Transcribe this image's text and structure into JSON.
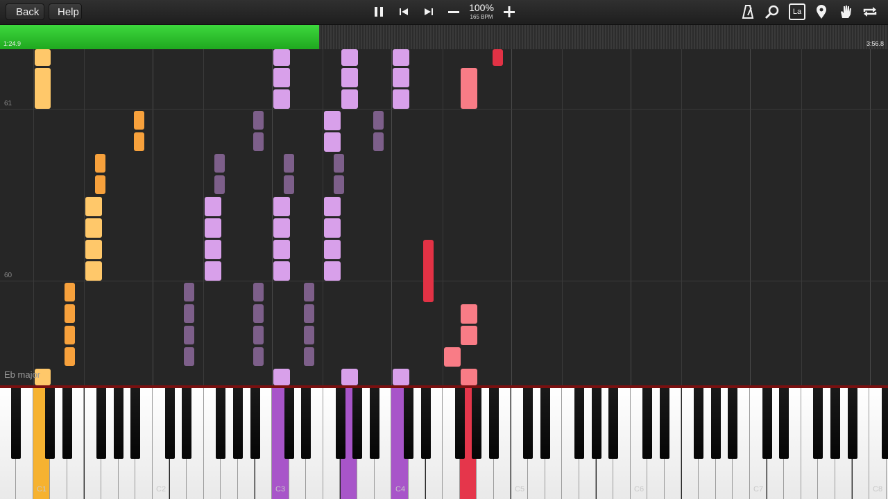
{
  "toolbar": {
    "back_label": "Back",
    "help_label": "Help",
    "speed": "100%",
    "bpm": "165 BPM",
    "icons": [
      "pause-icon",
      "skip-previous-icon",
      "skip-next-icon",
      "minus-icon",
      "plus-icon",
      "metronome-icon",
      "zoom-icon",
      "label-icon",
      "marker-icon",
      "hand-icon",
      "loop-icon"
    ],
    "label_icon_text": "La"
  },
  "progress": {
    "elapsed": "1:24.9",
    "total": "3:56.8",
    "fraction": 0.359,
    "color": "#2ec42e"
  },
  "roll": {
    "measure_labels": [
      "61",
      "60"
    ],
    "key_signature": "Eb major"
  },
  "keyboard": {
    "octave_labels": [
      "C1",
      "C2",
      "C3",
      "C4",
      "C5",
      "C6",
      "C7",
      "C8"
    ],
    "active_keys": [
      {
        "label": "orange",
        "color": "#f6b230"
      },
      {
        "label": "purple",
        "color": "#a855c9"
      },
      {
        "label": "red",
        "color": "#e5364b"
      }
    ]
  },
  "colors": {
    "orange_light": "#ffc86a",
    "orange": "#f7a13c",
    "violet_light": "#d8a0ea",
    "violet_dim": "#7d5f8a",
    "coral": "#f97c86",
    "red": "#e23245",
    "accent_green": "#2ec42e"
  }
}
